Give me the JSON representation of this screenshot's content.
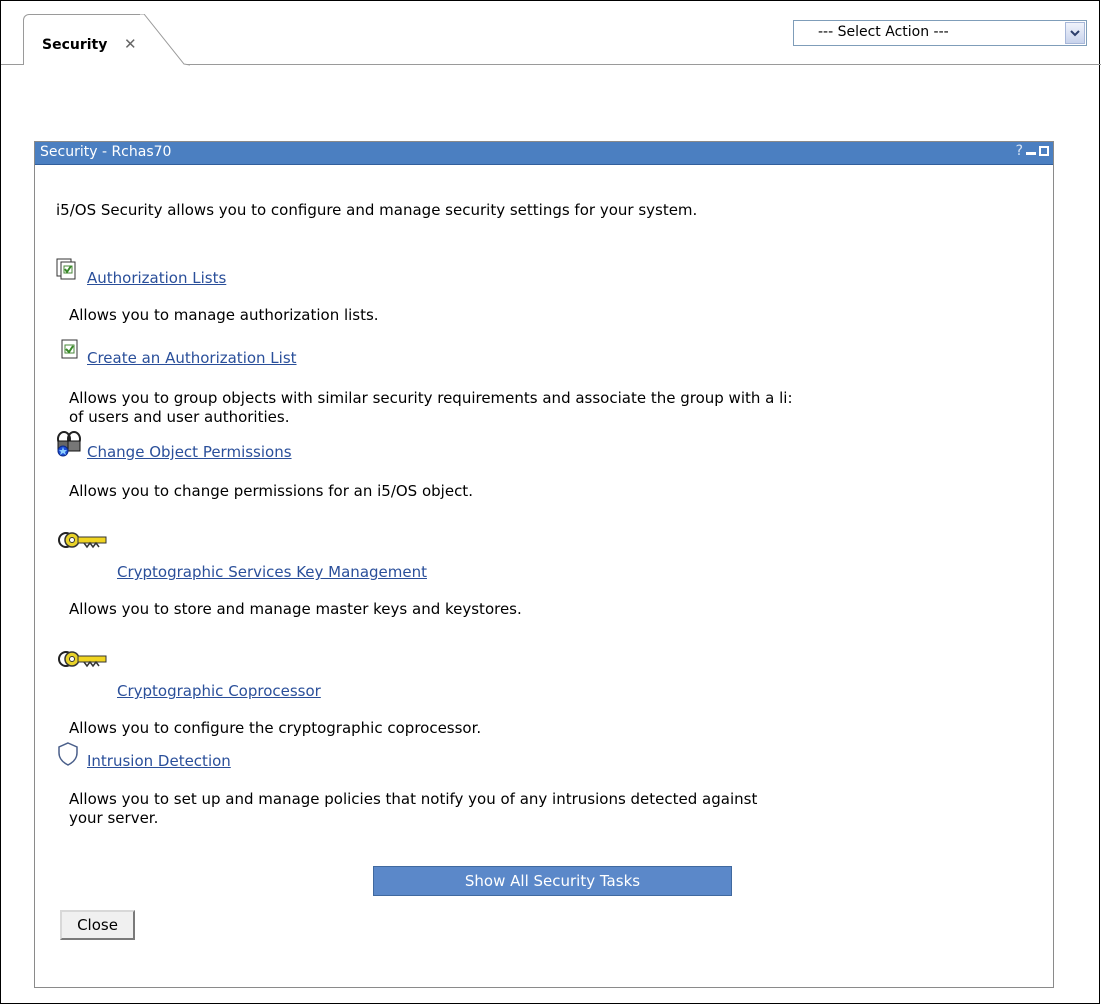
{
  "tab": {
    "label": "Security",
    "close": "✕"
  },
  "action_select": {
    "value": "--- Select Action ---"
  },
  "panel": {
    "title": "Security - Rchas70",
    "help": "?",
    "intro": "i5/OS Security allows you to configure and manage security settings for your system."
  },
  "items": [
    {
      "label": "Authorization Lists",
      "description": "Allows you to manage authorization lists."
    },
    {
      "label": "Create an Authorization List",
      "description": "Allows you to group objects with similar security requirements and associate the group with a li:",
      "description2": "of users and user authorities."
    },
    {
      "label": "Change Object Permissions",
      "description": "Allows you to change permissions for an i5/OS object."
    },
    {
      "label": "Cryptographic Services Key Management",
      "description": "Allows you to store and manage master keys and keystores."
    },
    {
      "label": "Cryptographic Coprocessor",
      "description": "Allows you to configure the cryptographic coprocessor."
    },
    {
      "label": "Intrusion Detection",
      "description": "Allows you to set up and manage policies that notify you of any intrusions detected against",
      "description2": "your server."
    }
  ],
  "buttons": {
    "show_all": "Show All Security Tasks",
    "close": "Close"
  },
  "colors": {
    "titlebar": "#4b7fc1",
    "link": "#2a4f9a",
    "button": "#5b88c9"
  }
}
